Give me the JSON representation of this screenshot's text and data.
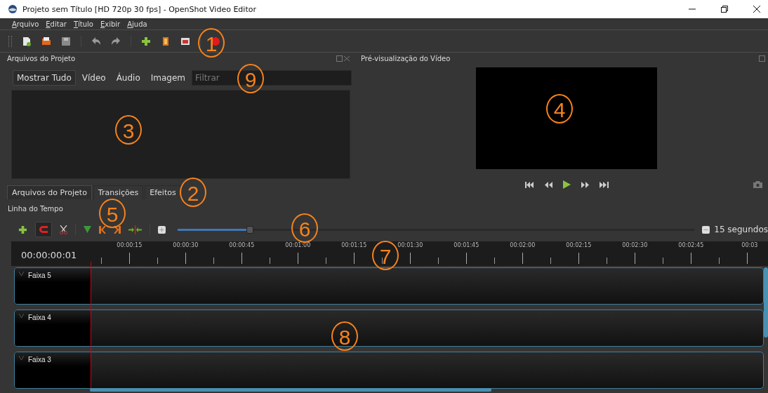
{
  "window": {
    "title": "Projeto sem Título [HD 720p 30 fps] - OpenShot Video Editor"
  },
  "menu": [
    "Arquivo",
    "Editar",
    "Título",
    "Exibir",
    "Ajuda"
  ],
  "project_files": {
    "title": "Arquivos do Projeto",
    "filters": [
      {
        "label": "Mostrar Tudo",
        "selected": true
      },
      {
        "label": "Vídeo",
        "selected": false
      },
      {
        "label": "Áudio",
        "selected": false
      },
      {
        "label": "Imagem",
        "selected": false
      }
    ],
    "search": {
      "placeholder": "Filtrar"
    }
  },
  "bottom_tabs": [
    {
      "label": "Arquivos do Projeto",
      "selected": true
    },
    {
      "label": "Transições",
      "selected": false
    },
    {
      "label": "Efeitos",
      "selected": false
    }
  ],
  "preview": {
    "title": "Pré-visualização do Vídeo"
  },
  "timeline": {
    "title": "Linha do Tempo",
    "zoom": {
      "level": 0.14,
      "reading": "15 segundos"
    },
    "timecode": "00:00:00:01",
    "ruler": [
      "00:00:15",
      "00:00:30",
      "00:00:45",
      "00:01:00",
      "00:01:15",
      "00:01:30",
      "00:01:45",
      "00:02:00",
      "00:02:15",
      "00:02:30",
      "00:02:45",
      "00:03"
    ],
    "tracks": [
      {
        "name": "Faixa 5"
      },
      {
        "name": "Faixa 4"
      },
      {
        "name": "Faixa 3"
      }
    ]
  },
  "callouts": [
    "1",
    "2",
    "3",
    "4",
    "5",
    "6",
    "7",
    "8",
    "9"
  ]
}
